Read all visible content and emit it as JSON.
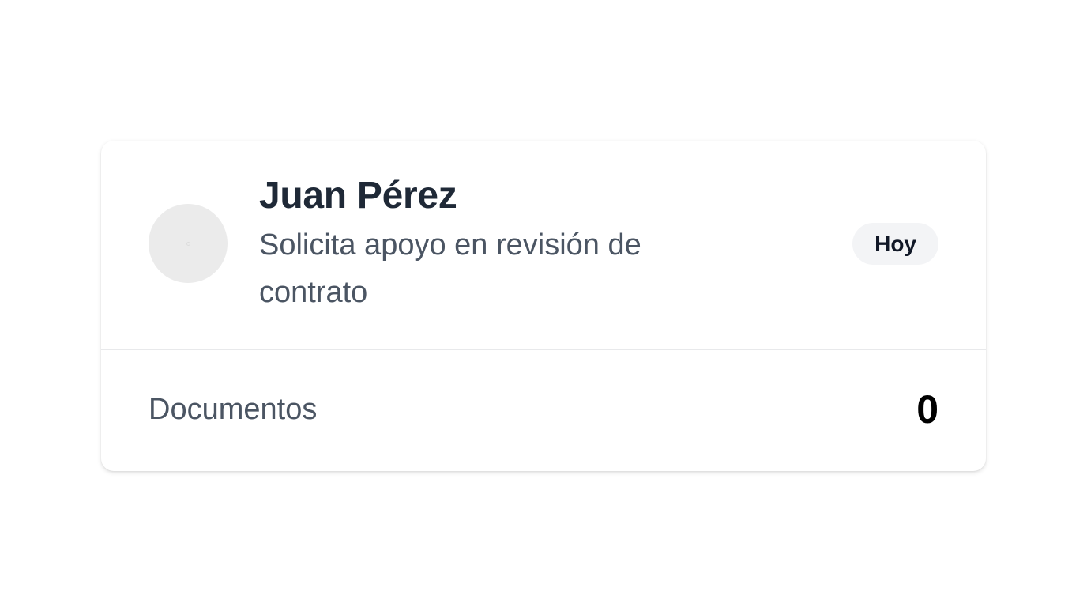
{
  "card": {
    "name": "Juan Pérez",
    "message": "Solicita apoyo en revisión de contrato",
    "badge": "Hoy",
    "documents_label": "Documentos",
    "documents_count": "0"
  },
  "colors": {
    "name": "#1f2937",
    "secondary_text": "#4b5563",
    "badge_bg": "#f3f4f6",
    "avatar_bg": "#ebebeb",
    "divider": "#e8e9eb"
  },
  "icons": {
    "avatar": "avatar-placeholder-icon"
  }
}
